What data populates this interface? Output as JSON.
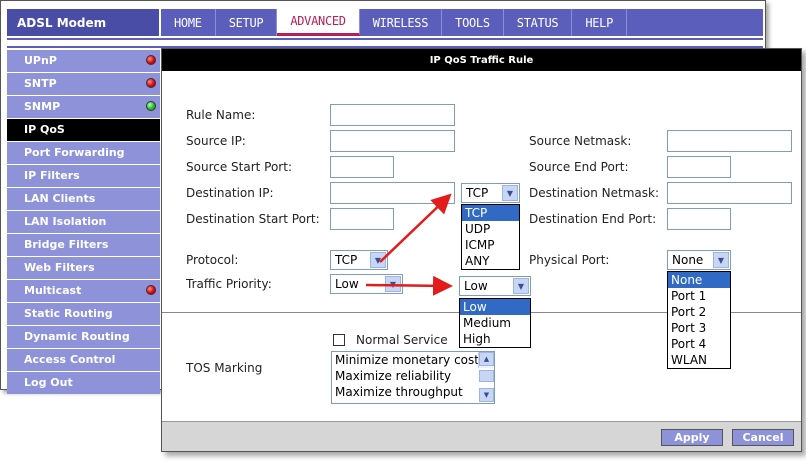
{
  "app": {
    "brand": "ADSL Modem"
  },
  "top_nav": [
    {
      "label": "HOME",
      "active": false
    },
    {
      "label": "SETUP",
      "active": false
    },
    {
      "label": "ADVANCED",
      "active": true
    },
    {
      "label": "WIRELESS",
      "active": false
    },
    {
      "label": "TOOLS",
      "active": false
    },
    {
      "label": "STATUS",
      "active": false
    },
    {
      "label": "HELP",
      "active": false
    }
  ],
  "sidebar": [
    {
      "label": "UPnP",
      "status": "red"
    },
    {
      "label": "SNTP",
      "status": "red"
    },
    {
      "label": "SNMP",
      "status": "green"
    },
    {
      "label": "IP QoS",
      "active": true
    },
    {
      "label": "Port Forwarding"
    },
    {
      "label": "IP Filters"
    },
    {
      "label": "LAN Clients"
    },
    {
      "label": "LAN Isolation"
    },
    {
      "label": "Bridge Filters"
    },
    {
      "label": "Web Filters"
    },
    {
      "label": "Multicast",
      "status": "red"
    },
    {
      "label": "Static Routing"
    },
    {
      "label": "Dynamic Routing"
    },
    {
      "label": "Access Control"
    },
    {
      "label": "Log Out"
    }
  ],
  "form": {
    "title": "IP QoS Traffic Rule",
    "labels": {
      "rule_name": "Rule Name:",
      "source_ip": "Source IP:",
      "source_netmask": "Source Netmask:",
      "source_start_port": "Source Start Port:",
      "source_end_port": "Source End Port:",
      "destination_ip": "Destination IP:",
      "destination_netmask": "Destination Netmask:",
      "destination_start_port": "Destination Start Port:",
      "destination_end_port": "Destination End Port:",
      "protocol": "Protocol:",
      "physical_port": "Physical Port:",
      "traffic_priority": "Traffic Priority:",
      "tos_marking": "TOS Marking"
    },
    "protocol": {
      "value": "TCP",
      "options": [
        "TCP",
        "UDP",
        "ICMP",
        "ANY"
      ],
      "highlighted": "TCP"
    },
    "traffic_priority": {
      "value": "Low",
      "options": [
        "Low",
        "Medium",
        "High"
      ],
      "highlighted": "Low"
    },
    "physical_port": {
      "value": "None",
      "options": [
        "None",
        "Port 1",
        "Port 2",
        "Port 3",
        "Port 4",
        "WLAN"
      ],
      "highlighted": "None"
    },
    "normal_service": {
      "label": "Normal Service",
      "checked": false
    },
    "tos_options": [
      "Minimize monetary cost",
      "Maximize reliability",
      "Maximize throughput"
    ]
  },
  "buttons": {
    "apply": "Apply",
    "cancel": "Cancel"
  },
  "colors": {
    "nav_blue": "#5b5fbb",
    "sidebar_blue": "#8d92d9",
    "active_tab_text": "#b51f55",
    "annotation_arrow": "#e21b1b"
  },
  "icons": [
    "status-dot-red",
    "status-dot-green",
    "dropdown-arrow-icon",
    "red-annotation-arrow"
  ]
}
